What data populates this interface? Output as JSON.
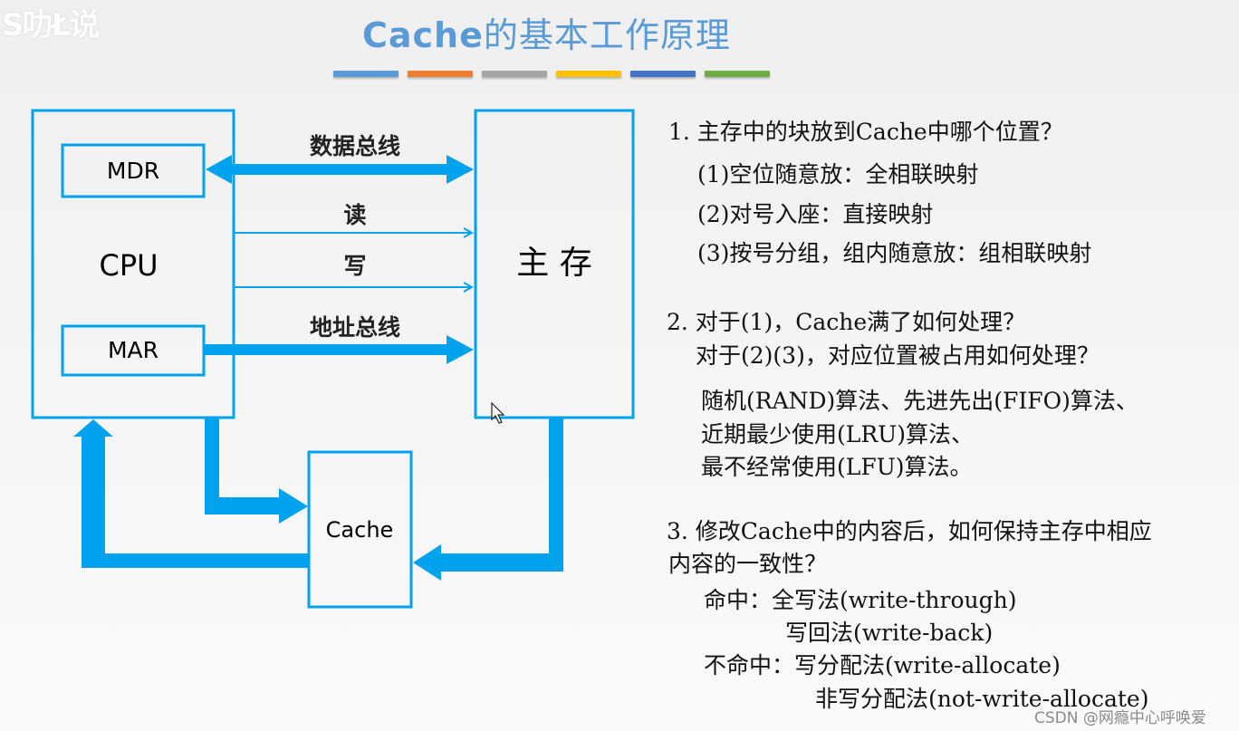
{
  "watermark": "S叻Ł说",
  "title": {
    "en": "Cache",
    "cn": "的基本工作原理"
  },
  "accent_bars": [
    "#5b9bd5",
    "#ed7d31",
    "#a5a5a5",
    "#ffc000",
    "#4472c4",
    "#70ad47"
  ],
  "diagram": {
    "color": "#00a2ed",
    "cpu_label": "CPU",
    "mdr_label": "MDR",
    "mar_label": "MAR",
    "memory_label": "主 存",
    "cache_label": "Cache",
    "data_bus_label": "数据总线",
    "read_label": "读",
    "write_label": "写",
    "address_bus_label": "地址总线"
  },
  "questions": [
    {
      "lines": [
        "1. 主存中的块放到Cache中哪个位置？",
        "(1)空位随意放：全相联映射",
        "(2)对号入座：直接映射",
        "(3)按号分组，组内随意放：组相联映射"
      ]
    },
    {
      "lines": [
        "2. 对于(1)，Cache满了如何处理？",
        "对于(2)(3)，对应位置被占用如何处理？",
        "随机(RAND)算法、先进先出(FIFO)算法、",
        "近期最少使用(LRU)算法、",
        "最不经常使用(LFU)算法。"
      ]
    },
    {
      "lines": [
        "3. 修改Cache中的内容后，如何保持主存中相应",
        "内容的一致性？",
        "命中：全写法(write-through)",
        "写回法(write-back)",
        "不命中：写分配法(write-allocate)",
        "非写分配法(not-write-allocate)"
      ]
    }
  ],
  "credit": "CSDN @网瘾中心呼唤爱"
}
